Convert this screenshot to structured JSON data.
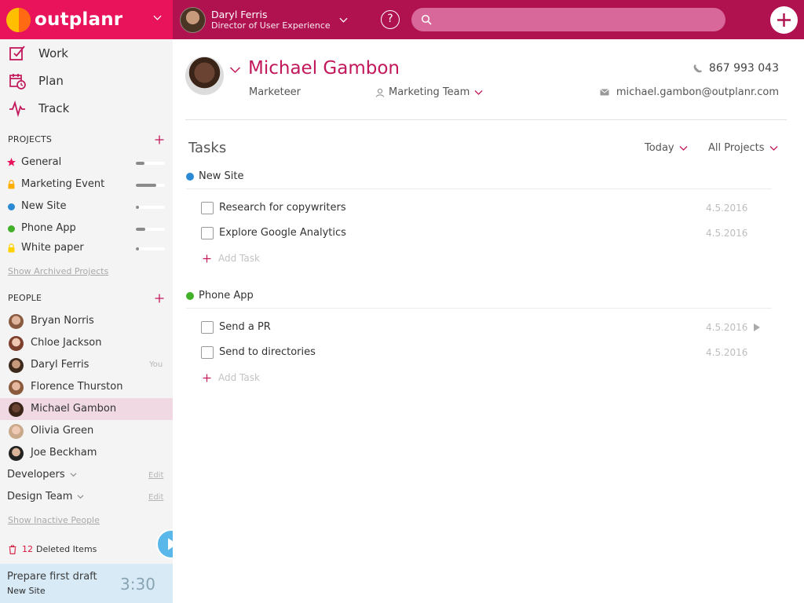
{
  "app": {
    "name": "outplanr"
  },
  "user": {
    "name": "Daryl Ferris",
    "role": "Director of User Experience"
  },
  "search": {
    "placeholder": ""
  },
  "nav": [
    {
      "label": "Work",
      "icon": "checkbox-edit-icon"
    },
    {
      "label": "Plan",
      "icon": "calendar-clock-icon"
    },
    {
      "label": "Track",
      "icon": "pulse-icon"
    }
  ],
  "projects_section": {
    "heading": "PROJECTS",
    "items": [
      {
        "label": "General",
        "color": "#e8135a",
        "shape": "star",
        "progress": 0.3
      },
      {
        "label": "Marketing Event",
        "color": "#ffae00",
        "shape": "lock",
        "progress": 0.7
      },
      {
        "label": "New Site",
        "color": "#2a8ad4",
        "shape": "dot",
        "progress": 0.1
      },
      {
        "label": "Phone App",
        "color": "#43b02a",
        "shape": "dot",
        "progress": 0.3
      },
      {
        "label": "White paper",
        "color": "#ffd200",
        "shape": "lock",
        "progress": 0.1
      }
    ],
    "archived_link": "Show Archived Projects"
  },
  "people_section": {
    "heading": "PEOPLE",
    "items": [
      {
        "label": "Bryan Norris",
        "you": "",
        "active": false
      },
      {
        "label": "Chloe Jackson",
        "you": "",
        "active": false
      },
      {
        "label": "Daryl Ferris",
        "you": "You",
        "active": false
      },
      {
        "label": "Florence Thurston",
        "you": "",
        "active": false
      },
      {
        "label": "Michael Gambon",
        "you": "",
        "active": true
      },
      {
        "label": "Olivia Green",
        "you": "",
        "active": false
      },
      {
        "label": "Joe Beckham",
        "you": "",
        "active": false
      }
    ],
    "groups": [
      {
        "label": "Developers",
        "edit": "Edit"
      },
      {
        "label": "Design Team",
        "edit": "Edit"
      }
    ],
    "inactive_link": "Show Inactive People"
  },
  "deleted": {
    "count": "12",
    "label": "Deleted Items"
  },
  "player": {
    "title": "Prepare first draft",
    "project": "New Site",
    "time": "3:30"
  },
  "profile": {
    "name": "Michael Gambon",
    "role": "Marketeer",
    "team": "Marketing Team",
    "phone": "867 993 043",
    "email": "michael.gambon@outplanr.com"
  },
  "tasks": {
    "title": "Tasks",
    "filter_date": "Today",
    "filter_project": "All Projects",
    "add_label": "Add Task",
    "groups": [
      {
        "name": "New Site",
        "color": "#2a8ad4",
        "items": [
          {
            "label": "Research for copywriters",
            "date": "4.5.2016",
            "playing": false
          },
          {
            "label": "Explore Google Analytics",
            "date": "4.5.2016",
            "playing": false
          }
        ]
      },
      {
        "name": "Phone App",
        "color": "#43b02a",
        "items": [
          {
            "label": "Send a PR",
            "date": "4.5.2016",
            "playing": true
          },
          {
            "label": "Send to directories",
            "date": "4.5.2016",
            "playing": false
          }
        ]
      }
    ]
  }
}
